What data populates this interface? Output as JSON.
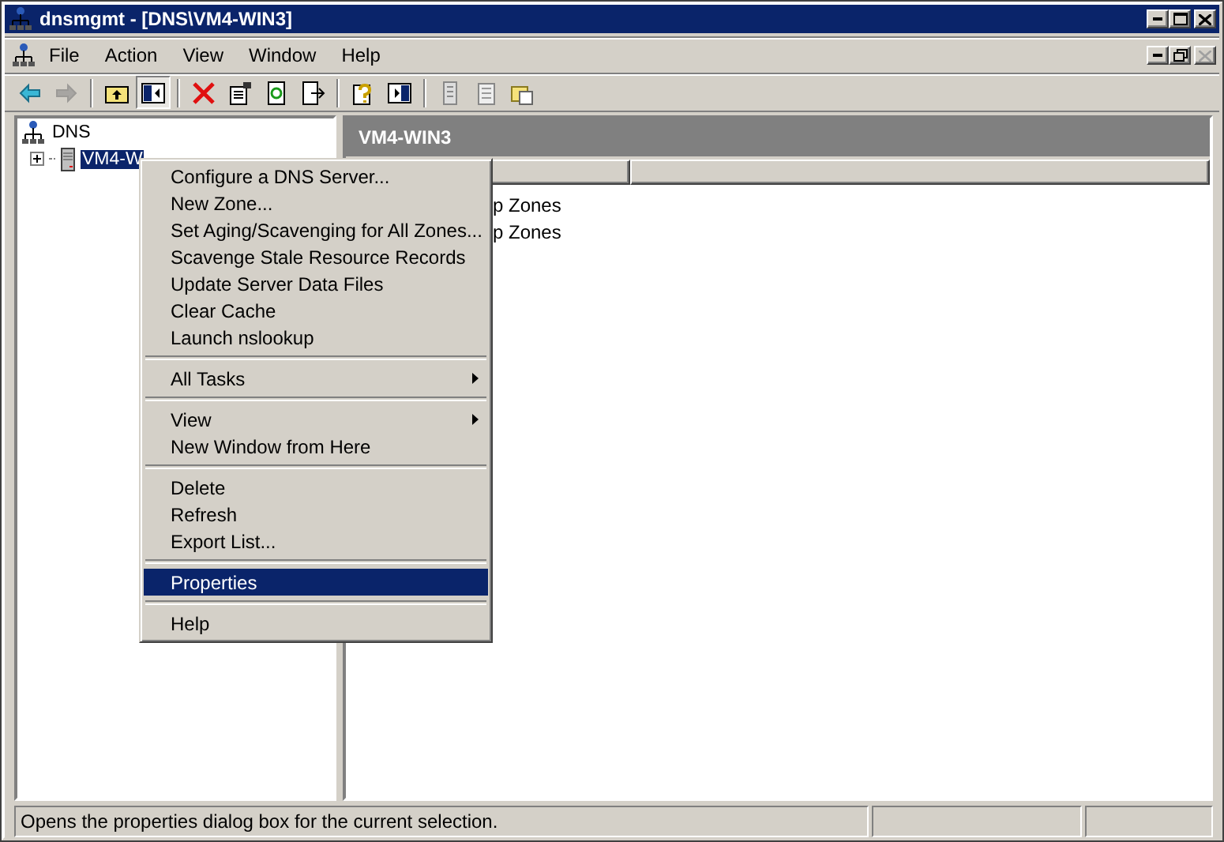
{
  "window": {
    "title": "dnsmgmt - [DNS\\VM4-WIN3]"
  },
  "menu_bar": [
    {
      "label": "File"
    },
    {
      "label": "Action"
    },
    {
      "label": "View"
    },
    {
      "label": "Window"
    },
    {
      "label": "Help"
    }
  ],
  "toolbar": [
    {
      "kind": "back",
      "pressed": false,
      "disabled": false
    },
    {
      "kind": "forward",
      "pressed": false,
      "disabled": true
    },
    {
      "kind": "separator"
    },
    {
      "kind": "up",
      "pressed": false,
      "disabled": false
    },
    {
      "kind": "tree",
      "pressed": true,
      "disabled": false
    },
    {
      "kind": "separator"
    },
    {
      "kind": "delete",
      "pressed": false,
      "disabled": false
    },
    {
      "kind": "properties",
      "pressed": false,
      "disabled": false
    },
    {
      "kind": "refresh",
      "pressed": false,
      "disabled": false
    },
    {
      "kind": "export",
      "pressed": false,
      "disabled": false
    },
    {
      "kind": "separator"
    },
    {
      "kind": "help",
      "pressed": false,
      "disabled": false
    },
    {
      "kind": "pane",
      "pressed": false,
      "disabled": false
    },
    {
      "kind": "separator"
    },
    {
      "kind": "page",
      "pressed": false,
      "disabled": false
    },
    {
      "kind": "notes",
      "pressed": false,
      "disabled": false
    },
    {
      "kind": "folder",
      "pressed": false,
      "disabled": false
    }
  ],
  "tree": [
    {
      "label": "DNS",
      "kind": "root",
      "selected": false,
      "children": [
        {
          "label": "VM4-W",
          "kind": "server",
          "selected": true,
          "expanded": false
        }
      ]
    }
  ],
  "right_pane": {
    "title": "VM4-WIN3",
    "rows": [
      {
        "label": "p Zones"
      },
      {
        "label": "p Zones"
      }
    ]
  },
  "context_menu": [
    {
      "kind": "item",
      "label": "Configure a DNS Server...",
      "selected": false
    },
    {
      "kind": "item",
      "label": "New Zone...",
      "selected": false
    },
    {
      "kind": "item",
      "label": "Set Aging/Scavenging for All Zones...",
      "selected": false
    },
    {
      "kind": "item",
      "label": "Scavenge Stale Resource Records",
      "selected": false
    },
    {
      "kind": "item",
      "label": "Update Server Data Files",
      "selected": false
    },
    {
      "kind": "item",
      "label": "Clear Cache",
      "selected": false
    },
    {
      "kind": "item",
      "label": "Launch nslookup",
      "selected": false
    },
    {
      "kind": "separator"
    },
    {
      "kind": "submenu",
      "label": "All Tasks",
      "selected": false
    },
    {
      "kind": "separator"
    },
    {
      "kind": "submenu",
      "label": "View",
      "selected": false
    },
    {
      "kind": "item",
      "label": "New Window from Here",
      "selected": false
    },
    {
      "kind": "separator"
    },
    {
      "kind": "item",
      "label": "Delete",
      "selected": false
    },
    {
      "kind": "item",
      "label": "Refresh",
      "selected": false
    },
    {
      "kind": "item",
      "label": "Export List...",
      "selected": false
    },
    {
      "kind": "separator"
    },
    {
      "kind": "item",
      "label": "Properties",
      "selected": true
    },
    {
      "kind": "separator"
    },
    {
      "kind": "item",
      "label": "Help",
      "selected": false
    }
  ],
  "status_bar": {
    "text": "Opens the properties dialog box for the current selection."
  }
}
